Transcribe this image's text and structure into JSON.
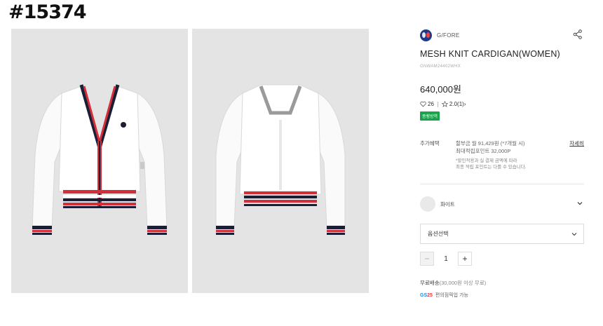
{
  "stamp": "#15374",
  "brand": {
    "name": "G/FORE"
  },
  "product": {
    "title": "MESH KNIT CARDIGAN(WOMEN)",
    "code": "GNWAM24402WHX",
    "price": "640,000원",
    "likes": "26",
    "rating": "2.0",
    "reviews": "(1)",
    "badge": "종횡방역"
  },
  "benefit": {
    "label": "추가혜택",
    "line1": "할부금 월 91,429원 (*7개월 시)",
    "line2": "최대적립포인트 32,000P",
    "note1": "*할인적용과 실 결제 금액에 따라",
    "note2": "최종 적립 포인트는 다를 수 있습니다.",
    "more": "자세히"
  },
  "color_option": {
    "label": "화이트"
  },
  "option_select": {
    "placeholder": "옵션선택"
  },
  "quantity": {
    "value": "1",
    "minus": "−",
    "plus": "+"
  },
  "shipping": {
    "text": "무료배송",
    "detail": "(30,000원 이상 무료)"
  },
  "pickup": {
    "logo_a": "GS",
    "logo_b": "25",
    "text": "편의점픽업 가능"
  },
  "colors": {
    "accent_green": "#1aa34a",
    "stripe_red": "#d32f3a",
    "stripe_navy": "#1a1f36"
  }
}
